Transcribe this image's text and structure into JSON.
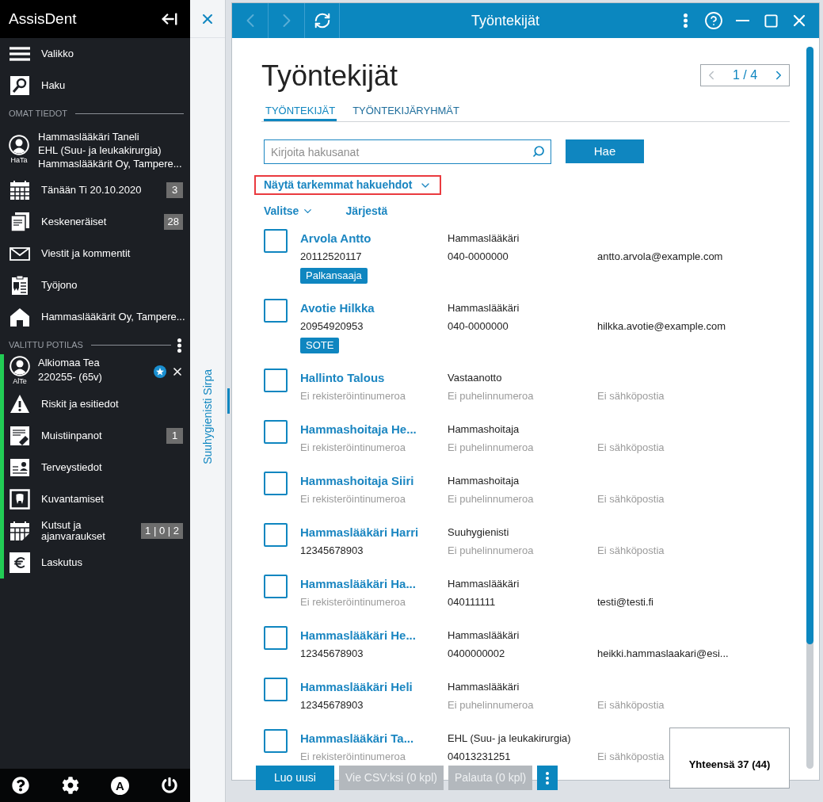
{
  "sidebar": {
    "app_title": "AssisDent",
    "top_items": [
      {
        "label": "Valikko",
        "kind": "menu"
      },
      {
        "label": "Haku",
        "kind": "search"
      }
    ],
    "own_section": {
      "heading": "OMAT TIEDOT",
      "user": {
        "initials": "HaTa",
        "name": "Hammaslääkäri Taneli",
        "specialty": "EHL (Suu- ja leukakirurgia)",
        "organization": "Hammaslääkärit Oy, Tampere..."
      },
      "items": [
        {
          "label": "Tänään Ti 20.10.2020",
          "kind": "calendar",
          "badge": "3"
        },
        {
          "label": "Keskeneräiset",
          "kind": "documents",
          "badge": "28"
        },
        {
          "label": "Viestit ja kommentit",
          "kind": "mail"
        },
        {
          "label": "Työjono",
          "kind": "queue"
        },
        {
          "label": "Hammaslääkärit Oy, Tampere...",
          "kind": "home"
        }
      ]
    },
    "patient_section": {
      "heading": "VALITTU POTILAS",
      "patient": {
        "initials": "AlTe",
        "name": "Alkiomaa Tea",
        "id_age": "220255- (65v)",
        "starred": true
      },
      "items": [
        {
          "label": "Riskit ja esitiedot",
          "kind": "warning"
        },
        {
          "label": "Muistiinpanot",
          "kind": "note",
          "badge": "1"
        },
        {
          "label": "Terveystiedot",
          "kind": "health"
        },
        {
          "label": "Kuvantamiset",
          "kind": "imaging"
        },
        {
          "label": "Kutsut ja ajanvaraukset",
          "kind": "appointments",
          "badge": "1 | 0 | 2"
        },
        {
          "label": "Laskutus",
          "kind": "billing"
        }
      ]
    },
    "footer": {
      "account_letter": "A"
    }
  },
  "side_panel": {
    "label": "Suuhygienisti Sirpa"
  },
  "window": {
    "title": "Työntekijät",
    "back_disabled": true,
    "forward_disabled": true
  },
  "page": {
    "heading": "Työntekijät",
    "pager": {
      "label": "1 / 4",
      "prev_disabled": true,
      "next_disabled": false
    },
    "tabs": [
      {
        "label": "TYÖNTEKIJÄT",
        "selected": true
      },
      {
        "label": "TYÖNTEKIJÄRYHMÄT",
        "selected": false
      }
    ],
    "search": {
      "placeholder": "Kirjoita hakusanat",
      "button": "Hae"
    },
    "advanced_toggle": {
      "label": "Näytä tarkemmat hakuehdot",
      "highlighted": true
    },
    "list_actions": [
      {
        "label": "Valitse",
        "kind": "dropdown"
      },
      {
        "label": "Järjestä",
        "kind": "link"
      }
    ],
    "employees": [
      {
        "checked": false,
        "name": "Arvola Antto",
        "registration": {
          "text": "20112520117",
          "missing": false
        },
        "tag": "Palkansaaja",
        "title": "Hammaslääkäri",
        "phone": {
          "text": "040-0000000",
          "missing": false
        },
        "email": {
          "text": "antto.arvola@example.com",
          "missing": false
        }
      },
      {
        "checked": false,
        "name": "Avotie Hilkka",
        "registration": {
          "text": "20954920953",
          "missing": false
        },
        "tag": "SOTE",
        "title": "Hammaslääkäri",
        "phone": {
          "text": "040-0000000",
          "missing": false
        },
        "email": {
          "text": "hilkka.avotie@example.com",
          "missing": false
        }
      },
      {
        "checked": false,
        "name": "Hallinto Talous",
        "registration": {
          "text": "Ei rekisteröintinumeroa",
          "missing": true
        },
        "title": "Vastaanotto",
        "phone": {
          "text": "Ei puhelinnumeroa",
          "missing": true
        },
        "email": {
          "text": "Ei sähköpostia",
          "missing": true
        }
      },
      {
        "checked": false,
        "name": "Hammashoitaja He...",
        "registration": {
          "text": "Ei rekisteröintinumeroa",
          "missing": true
        },
        "title": "Hammashoitaja",
        "phone": {
          "text": "Ei puhelinnumeroa",
          "missing": true
        },
        "email": {
          "text": "Ei sähköpostia",
          "missing": true
        }
      },
      {
        "checked": false,
        "name": "Hammashoitaja Siiri",
        "registration": {
          "text": "Ei rekisteröintinumeroa",
          "missing": true
        },
        "title": "Hammashoitaja",
        "phone": {
          "text": "Ei puhelinnumeroa",
          "missing": true
        },
        "email": {
          "text": "Ei sähköpostia",
          "missing": true
        }
      },
      {
        "checked": false,
        "name": "Hammaslääkäri Harri",
        "registration": {
          "text": "12345678903",
          "missing": false
        },
        "title": "Suuhygienisti",
        "phone": {
          "text": "Ei puhelinnumeroa",
          "missing": true
        },
        "email": {
          "text": "Ei sähköpostia",
          "missing": true
        }
      },
      {
        "checked": false,
        "name": "Hammaslääkäri Ha...",
        "registration": {
          "text": "Ei rekisteröintinumeroa",
          "missing": true
        },
        "title": "Hammaslääkäri",
        "phone": {
          "text": "040111111",
          "missing": false
        },
        "email": {
          "text": "testi@testi.fi",
          "missing": false
        }
      },
      {
        "checked": false,
        "name": "Hammaslääkäri He...",
        "registration": {
          "text": "12345678903",
          "missing": false
        },
        "title": "Hammaslääkäri",
        "phone": {
          "text": "0400000002",
          "missing": false
        },
        "email": {
          "text": "heikki.hammaslaakari@esi...",
          "missing": false
        }
      },
      {
        "checked": false,
        "name": "Hammaslääkäri Heli",
        "registration": {
          "text": "12345678903",
          "missing": false
        },
        "title": "Hammaslääkäri",
        "phone": {
          "text": "Ei puhelinnumeroa",
          "missing": true
        },
        "email": {
          "text": "Ei sähköpostia",
          "missing": true
        }
      },
      {
        "checked": false,
        "name": "Hammaslääkäri Ta...",
        "registration": {
          "text": "Ei rekisteröintinumeroa",
          "missing": true
        },
        "title": "EHL (Suu- ja leukakirurgia)",
        "phone": {
          "text": "04013231251",
          "missing": false
        },
        "email": {
          "text": "Ei sähköpostia",
          "missing": true
        }
      }
    ]
  },
  "actions": [
    {
      "label": "Luo uusi",
      "disabled": false
    },
    {
      "label": "Vie CSV:ksi (0 kpl)",
      "disabled": true
    },
    {
      "label": "Palauta (0 kpl)",
      "disabled": true
    }
  ],
  "total": "Yhteensä 37 (44)"
}
